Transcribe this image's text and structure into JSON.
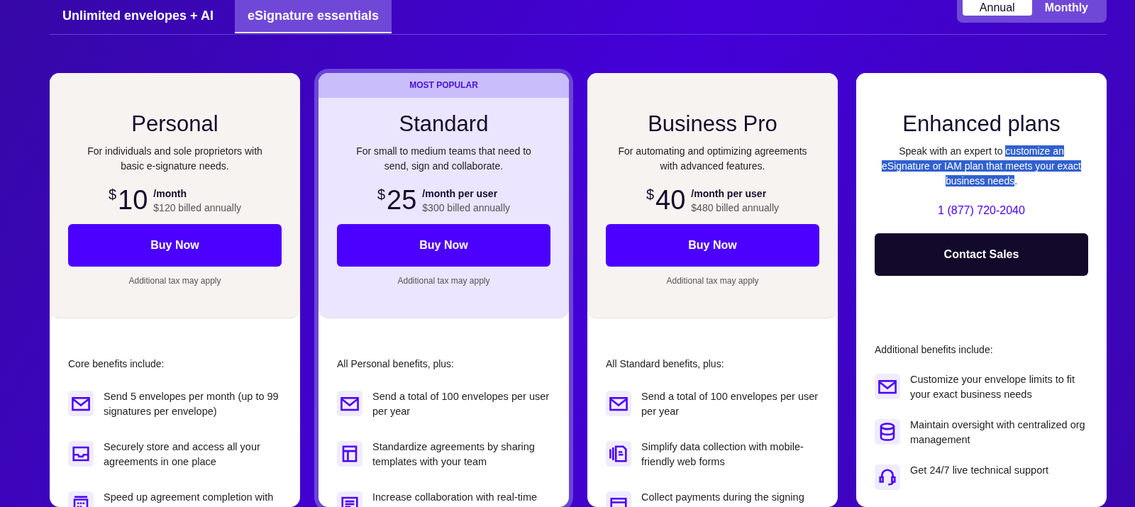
{
  "tabs": [
    {
      "label": "Unlimited envelopes + AI",
      "selected": false
    },
    {
      "label": "eSignature essentials",
      "selected": true
    }
  ],
  "billing_toggle": [
    {
      "label": "Annual",
      "selected": true
    },
    {
      "label": "Monthly",
      "selected": false
    }
  ],
  "plans": [
    {
      "kind": "priced",
      "name": "Personal",
      "featured": false,
      "description": [
        {
          "text": "For individuals and sole proprietors with basic e-signature needs.",
          "highlighted": false
        }
      ],
      "currency": "$",
      "amount": "10",
      "period": "/month",
      "billing": "$120 billed annually",
      "button": "Buy Now",
      "note": "Additional tax may apply",
      "benefits_heading": "Core benefits include:",
      "benefits": [
        {
          "kind": "envelope",
          "text": "Send 5 envelopes per month (up to 99 signatures per envelope)"
        },
        {
          "kind": "tray",
          "text": "Securely store and access all your agreements in one place"
        },
        {
          "kind": "calendar",
          "text": "Speed up agreement completion with"
        }
      ]
    },
    {
      "kind": "priced",
      "name": "Standard",
      "badge": "MOST POPULAR",
      "featured": true,
      "description": [
        {
          "text": "For small to medium teams that need to send, sign and collaborate.",
          "highlighted": false
        }
      ],
      "currency": "$",
      "amount": "25",
      "period": "/month per user",
      "billing": "$300 billed annually",
      "button": "Buy Now",
      "note": "Additional tax may apply",
      "benefits_heading": "All Personal benefits, plus:",
      "benefits": [
        {
          "kind": "envelope",
          "text": "Send a total of 100 envelopes per user per year"
        },
        {
          "kind": "template",
          "text": "Standardize agreements by sharing templates with your team"
        },
        {
          "kind": "document",
          "text": "Increase collaboration with real-time"
        }
      ]
    },
    {
      "kind": "priced",
      "name": "Business Pro",
      "featured": false,
      "description": [
        {
          "text": "For automating and optimizing agreements with advanced features.",
          "highlighted": false
        }
      ],
      "currency": "$",
      "amount": "40",
      "period": "/month per user",
      "billing": "$480 billed annually",
      "button": "Buy Now",
      "note": "Additional tax may apply",
      "benefits_heading": "All Standard benefits, plus:",
      "benefits": [
        {
          "kind": "envelope",
          "text": "Send a total of 100 envelopes per user per year"
        },
        {
          "kind": "form",
          "text": "Simplify data collection with mobile-friendly web forms"
        },
        {
          "kind": "card",
          "text": "Collect payments during the signing"
        }
      ]
    },
    {
      "kind": "contact",
      "name": "Enhanced plans",
      "featured": false,
      "description": [
        {
          "text": "Speak with an expert to ",
          "highlighted": false
        },
        {
          "text": "customize an eSignature or IAM plan that meets your exact business needs",
          "highlighted": true
        },
        {
          "text": ".",
          "highlighted": false
        }
      ],
      "phone": "1 (877) 720-2040",
      "button": "Contact Sales",
      "benefits_heading": "Additional benefits include:",
      "benefits": [
        {
          "kind": "envelope",
          "text": "Customize your envelope limits to fit your exact business needs"
        },
        {
          "kind": "database",
          "text": "Maintain oversight with centralized org management"
        },
        {
          "kind": "headset",
          "text": "Get 24/7 live technical support"
        }
      ]
    }
  ]
}
